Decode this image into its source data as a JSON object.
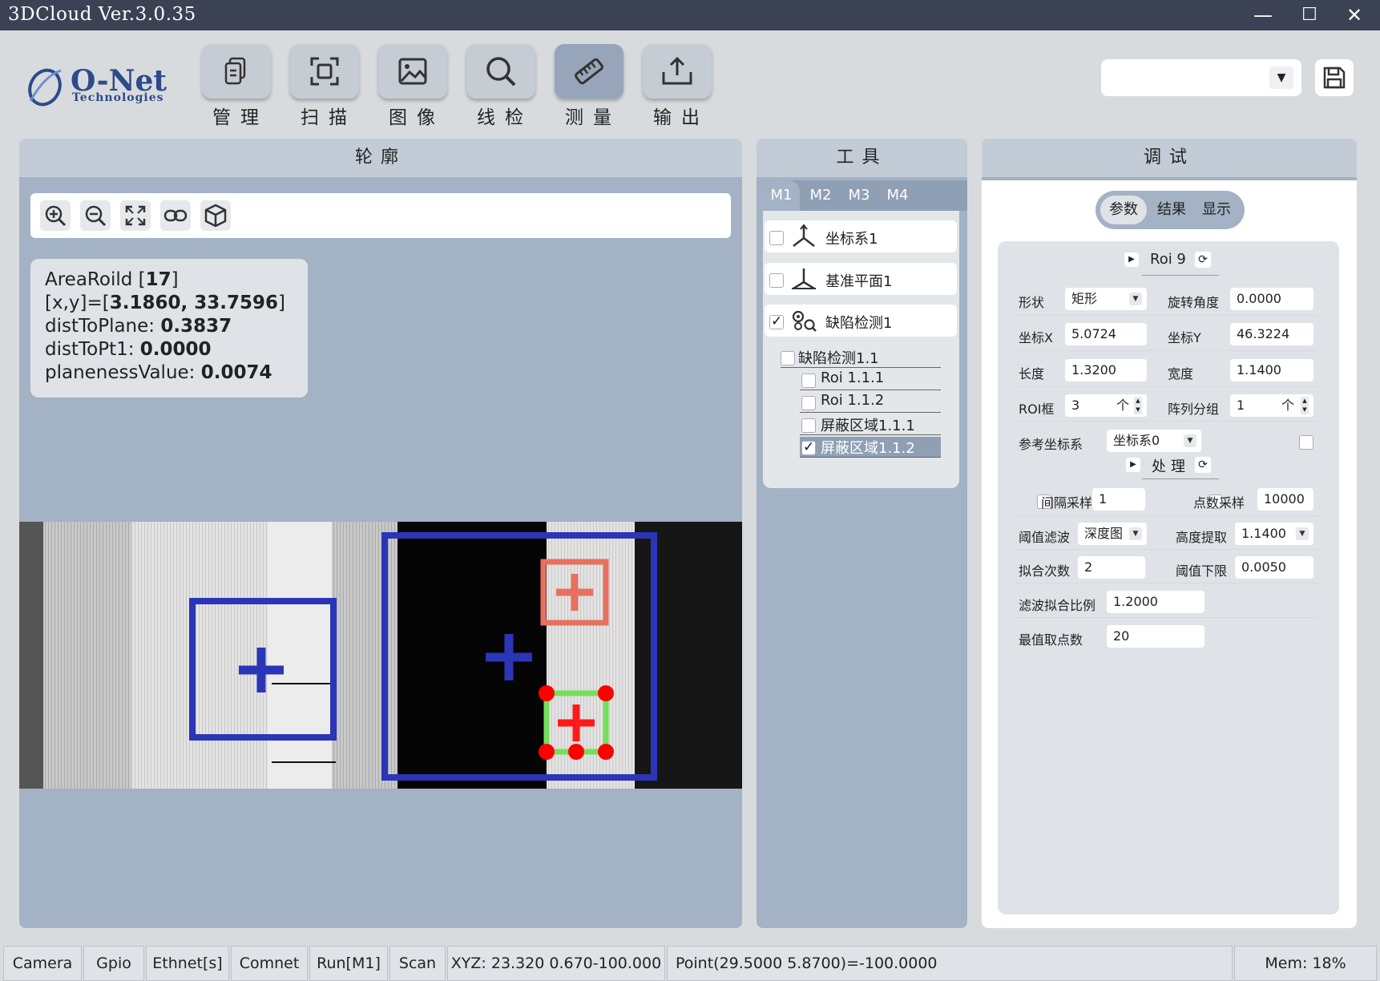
{
  "window": {
    "title": "3DCloud Ver.3.0.35",
    "min": "—",
    "max": "☐",
    "close": "✕"
  },
  "brand": {
    "logo_main": "O-Net",
    "logo_sub": "Technologies"
  },
  "toolbar": [
    {
      "label": "管理",
      "icon": "document-icon"
    },
    {
      "label": "扫描",
      "icon": "scan-icon"
    },
    {
      "label": "图像",
      "icon": "image-icon"
    },
    {
      "label": "线检",
      "icon": "search-icon"
    },
    {
      "label": "测量",
      "icon": "ruler-icon"
    },
    {
      "label": "输出",
      "icon": "export-icon"
    }
  ],
  "profile_select": {
    "value": ""
  },
  "profile_panel": {
    "title": "轮廓",
    "info": {
      "line1_label": "AreaRoild [",
      "line1_val": "17",
      "line1_end": "]",
      "line2_label": "[x,y]=[",
      "line2_val": "3.1860, 33.7596",
      "line2_end": "]",
      "line3_label": "distToPlane: ",
      "line3_val": "0.3837",
      "line4_label": "distToPt1: ",
      "line4_val": "0.0000",
      "line5_label": "planenessValue: ",
      "line5_val": "0.0074"
    }
  },
  "tools_panel": {
    "title": "工具",
    "tabs": [
      "M1",
      "M2",
      "M3",
      "M4"
    ],
    "items": [
      {
        "label": "坐标系1",
        "checked": false
      },
      {
        "label": "基准平面1",
        "checked": false
      },
      {
        "label": "缺陷检测1",
        "checked": true
      }
    ],
    "tree": [
      {
        "label": "缺陷检测1.1",
        "checked": false
      },
      {
        "label": "Roi 1.1.1",
        "checked": false
      },
      {
        "label": "Roi 1.1.2",
        "checked": false
      },
      {
        "label": "屏蔽区域1.1.1",
        "checked": false
      },
      {
        "label": "屏蔽区域1.1.2",
        "checked": true
      }
    ]
  },
  "debug_panel": {
    "title": "调试",
    "tabs": [
      "参数",
      "结果",
      "显示"
    ],
    "roi_title": "Roi 9",
    "fields": {
      "shape_label": "形状",
      "shape_val": "矩形",
      "rot_label": "旋转角度",
      "rot_val": "0.0000",
      "x_label": "坐标X",
      "x_val": "5.0724",
      "y_label": "坐标Y",
      "y_val": "46.3224",
      "len_label": "长度",
      "len_val": "1.3200",
      "wid_label": "宽度",
      "wid_val": "1.1400",
      "roi_label": "ROI框",
      "roi_val": "3",
      "roi_unit": "个",
      "arr_label": "阵列分组",
      "arr_val": "1",
      "arr_unit": "个",
      "ref_label": "参考坐标系",
      "ref_val": "坐标系0"
    },
    "proc_title": "处理",
    "proc": {
      "interval_label": "间隔采样",
      "interval_val": "1",
      "points_label": "点数采样",
      "points_val": "10000",
      "thr_label": "阈值滤波",
      "thr_val": "深度图",
      "height_label": "高度提取",
      "height_val": "1.1400",
      "fit_label": "拟合次数",
      "fit_val": "2",
      "low_label": "阈值下限",
      "low_val": "0.0050",
      "ratio_label": "滤波拟合比例",
      "ratio_val": "1.2000",
      "max_label": "最值取点数",
      "max_val": "20"
    }
  },
  "statusbar": [
    "Camera",
    "Gpio",
    "Ethnet[s]",
    "Comnet",
    "Run[M1]",
    "Scan",
    "XYZ: 23.320 0.670-100.000",
    "Point(29.5000 5.8700)=-100.0000",
    "Mem: 18%"
  ],
  "colors": {
    "accent": "#97a5ba",
    "roi_blue": "#2b35b8",
    "roi_red": "#e8705e",
    "roi_green": "#74e05a",
    "handle_red": "#ff0000"
  }
}
